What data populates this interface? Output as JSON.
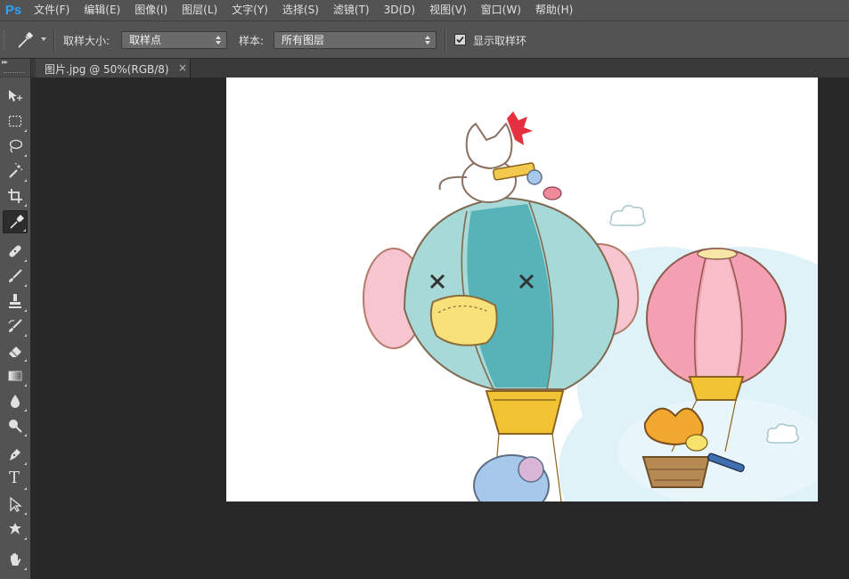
{
  "app": {
    "logo": "Ps"
  },
  "menu": [
    "文件(F)",
    "编辑(E)",
    "图像(I)",
    "图层(L)",
    "文字(Y)",
    "选择(S)",
    "滤镜(T)",
    "3D(D)",
    "视图(V)",
    "窗口(W)",
    "帮助(H)"
  ],
  "options": {
    "current_tool_icon": "eyedropper-icon",
    "sample_size_label": "取样大小:",
    "sample_size_value": "取样点",
    "sample_label": "样本:",
    "sample_value": "所有图层",
    "show_ring_label": "显示取样环",
    "show_ring_checked": true
  },
  "document_tab": {
    "label": "图片.jpg @ 50%(RGB/8)",
    "close": "×"
  },
  "tools": [
    {
      "name": "move-tool",
      "icon": "move-icon"
    },
    {
      "name": "marquee-tool",
      "icon": "rect-marquee-icon"
    },
    {
      "name": "lasso-tool",
      "icon": "lasso-icon"
    },
    {
      "name": "magic-wand-tool",
      "icon": "magic-wand-icon"
    },
    {
      "name": "crop-tool",
      "icon": "crop-icon"
    },
    {
      "name": "eyedropper-tool",
      "icon": "eyedropper-icon",
      "active": true
    },
    {
      "name": "healing-brush-tool",
      "icon": "bandage-icon"
    },
    {
      "name": "brush-tool",
      "icon": "brush-icon"
    },
    {
      "name": "clone-stamp-tool",
      "icon": "stamp-icon"
    },
    {
      "name": "history-brush-tool",
      "icon": "history-brush-icon"
    },
    {
      "name": "eraser-tool",
      "icon": "eraser-icon"
    },
    {
      "name": "gradient-tool",
      "icon": "gradient-icon"
    },
    {
      "name": "blur-tool",
      "icon": "drop-icon"
    },
    {
      "name": "dodge-tool",
      "icon": "dodge-icon"
    },
    {
      "name": "pen-tool",
      "icon": "pen-icon"
    },
    {
      "name": "type-tool",
      "icon": "type-icon"
    },
    {
      "name": "path-selection-tool",
      "icon": "arrow-icon"
    },
    {
      "name": "shape-tool",
      "icon": "custom-shape-icon"
    },
    {
      "name": "hand-tool",
      "icon": "hand-icon"
    }
  ],
  "type_tool_glyph": "T",
  "colors": {
    "menubar": "#535353",
    "workspace": "#282828",
    "ps_blue": "#2fa3f7"
  }
}
